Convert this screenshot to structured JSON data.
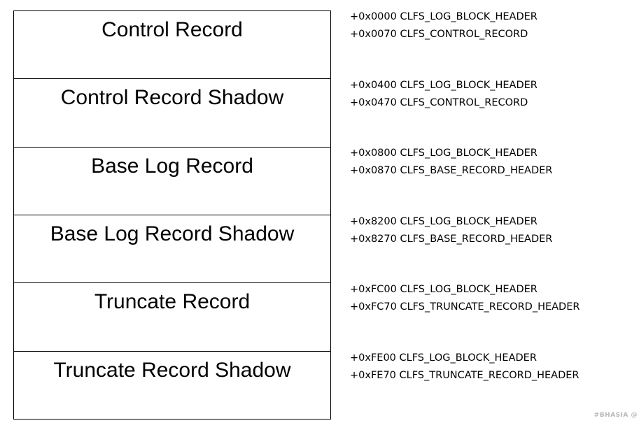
{
  "blocks": [
    {
      "label": "Control Record",
      "offsets": [
        "+0x0000 CLFS_LOG_BLOCK_HEADER",
        "+0x0070 CLFS_CONTROL_RECORD"
      ]
    },
    {
      "label": "Control Record Shadow",
      "offsets": [
        "+0x0400 CLFS_LOG_BLOCK_HEADER",
        "+0x0470 CLFS_CONTROL_RECORD"
      ]
    },
    {
      "label": "Base Log Record",
      "offsets": [
        "+0x0800 CLFS_LOG_BLOCK_HEADER",
        "+0x0870 CLFS_BASE_RECORD_HEADER"
      ]
    },
    {
      "label": "Base Log Record Shadow",
      "offsets": [
        "+0x8200 CLFS_LOG_BLOCK_HEADER",
        "+0x8270 CLFS_BASE_RECORD_HEADER"
      ]
    },
    {
      "label": "Truncate Record",
      "offsets": [
        "+0xFC00 CLFS_LOG_BLOCK_HEADER",
        "+0xFC70 CLFS_TRUNCATE_RECORD_HEADER"
      ]
    },
    {
      "label": "Truncate Record Shadow",
      "offsets": [
        "+0xFE00 CLFS_LOG_BLOCK_HEADER",
        "+0xFE70 CLFS_TRUNCATE_RECORD_HEADER"
      ]
    }
  ],
  "watermark": "#BHASIA @"
}
